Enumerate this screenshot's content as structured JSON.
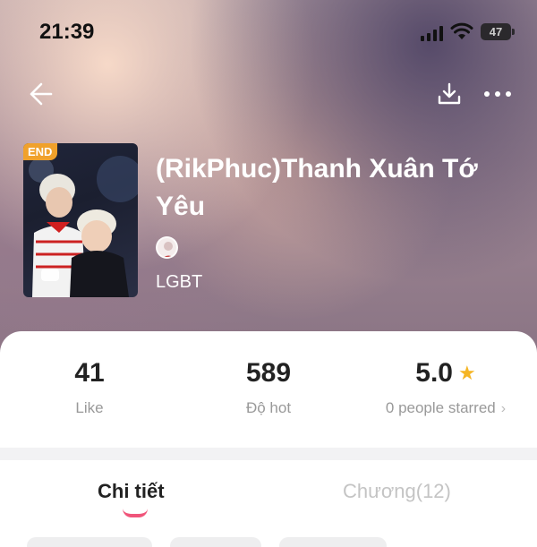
{
  "status_bar": {
    "time": "21:39",
    "battery": "47"
  },
  "header": {
    "back_icon": "arrow-left-icon",
    "download_icon": "download-icon",
    "more_icon": "more-horizontal-icon"
  },
  "book": {
    "badge": "END",
    "title": "(RikPhuc)Thanh Xuân Tớ Yêu",
    "genre": "LGBT"
  },
  "stats": {
    "like_value": "41",
    "like_label": "Like",
    "hot_value": "589",
    "hot_label": "Độ hot",
    "rating_value": "5.0",
    "rating_label": "0 people starred",
    "rating_chevron": "›"
  },
  "tabs": {
    "details": "Chi tiết",
    "chapters": "Chương(12)"
  },
  "colors": {
    "accent": "#f0557a",
    "star": "#f5b524",
    "badge": "#f0a12b"
  }
}
